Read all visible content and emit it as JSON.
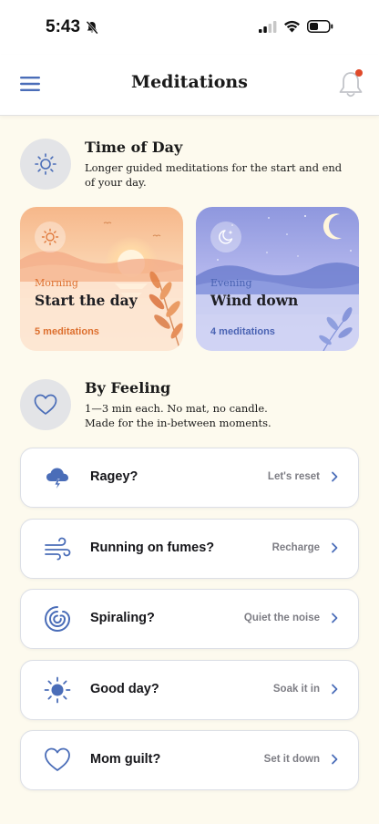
{
  "status_bar": {
    "time": "5:43"
  },
  "header": {
    "title": "Meditations"
  },
  "time_of_day": {
    "title": "Time of Day",
    "description": "Longer guided meditations for the start and end of your day.",
    "cards": [
      {
        "eyebrow": "Morning",
        "title": "Start the day",
        "count": "5 meditations",
        "accent": "#dd6f2e"
      },
      {
        "eyebrow": "Evening",
        "title": "Wind down",
        "count": "4 meditations",
        "accent": "#4a63b3"
      }
    ]
  },
  "by_feeling": {
    "title": "By Feeling",
    "description_line1": "1—3 min each. No mat, no candle.",
    "description_line2": "Made for the in-between moments.",
    "items": [
      {
        "label": "Ragey?",
        "action": "Let's reset",
        "icon": "storm-cloud-icon"
      },
      {
        "label": "Running on fumes?",
        "action": "Recharge",
        "icon": "wind-icon"
      },
      {
        "label": "Spiraling?",
        "action": "Quiet the noise",
        "icon": "spiral-icon"
      },
      {
        "label": "Good day?",
        "action": "Soak it in",
        "icon": "sun-icon"
      },
      {
        "label": "Mom guilt?",
        "action": "Set it down",
        "icon": "heart-icon"
      }
    ]
  },
  "colors": {
    "accent": "#4a6db8",
    "background": "#fdfaee",
    "notification": "#e04a2a"
  }
}
